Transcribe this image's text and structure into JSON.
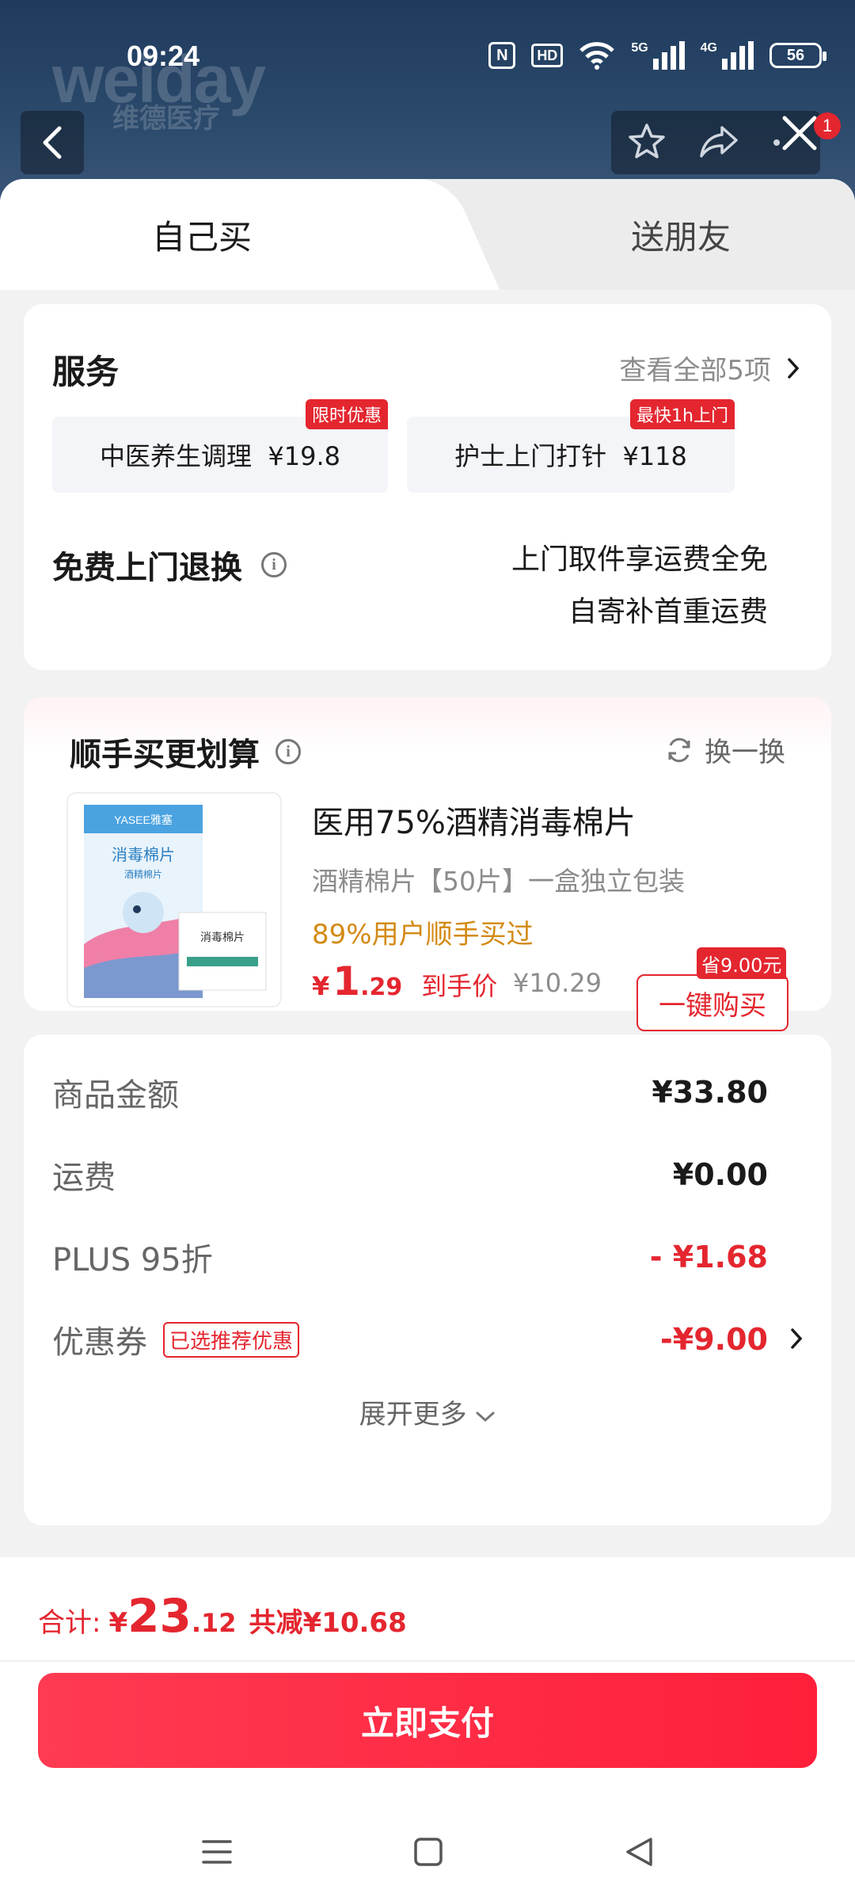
{
  "status_bar": {
    "time": "09:24",
    "nfc": "N",
    "hd": "HD",
    "net1": "5G",
    "net2": "4G",
    "battery": "56"
  },
  "brand": {
    "logo_text": "weiday",
    "sub_text": "维德医疗"
  },
  "top_badge": "1",
  "tabs": [
    {
      "label": "自己买",
      "active": true
    },
    {
      "label": "送朋友",
      "active": false
    }
  ],
  "services": {
    "title": "服务",
    "more_label": "查看全部5项",
    "chips": [
      {
        "label": "中医养生调理  ¥19.8",
        "tag": "限时优惠"
      },
      {
        "label": "护士上门打针  ¥118",
        "tag": "最快1h上门"
      }
    ],
    "return_title": "免费上门退换",
    "return_notes": [
      "上门取件享运费全免",
      "自寄补首重运费"
    ]
  },
  "recommend": {
    "title": "顺手买更划算",
    "swap_label": "换一换",
    "product": {
      "name": "医用75%酒精消毒棉片",
      "desc": "酒精棉片【50片】一盒独立包装",
      "hint": "89%用户顺手买过",
      "price_yen": "¥",
      "price_int": "1",
      "price_dec": ".29",
      "price_label": "到手价",
      "orig_price": "¥10.29",
      "buy_label": "一键购买",
      "save_tag": "省9.00元",
      "box_brand": "YASEE雅塞",
      "box_title": "消毒棉片",
      "box_sub": "酒精棉片",
      "pack_title": "消毒棉片"
    }
  },
  "summary": {
    "rows": [
      {
        "label": "商品金额",
        "value": "¥33.80",
        "red": false
      },
      {
        "label": "运费",
        "value": "¥0.00",
        "red": false
      },
      {
        "label": "PLUS 95折",
        "value": "- ¥1.68",
        "red": true
      },
      {
        "label": "优惠券",
        "value": "-¥9.00",
        "red": true,
        "tag": "已选推荐优惠"
      }
    ],
    "expand_label": "展开更多"
  },
  "footer": {
    "total_label": "合计:",
    "total_yen": "¥",
    "total_int": "23",
    "total_dec": ".12",
    "total_saving": "共减¥10.68",
    "pay_label": "立即支付"
  },
  "colors": {
    "accent": "#e4262f",
    "pay_button": "#ff2a45",
    "hint": "#d38a14"
  },
  "icons": [
    "back-arrow-icon",
    "star-icon",
    "share-icon",
    "more-icon",
    "close-icon",
    "info-icon",
    "refresh-icon",
    "chevron-right-icon",
    "chevron-down-icon",
    "menu-icon",
    "home-icon",
    "back-triangle-icon"
  ]
}
